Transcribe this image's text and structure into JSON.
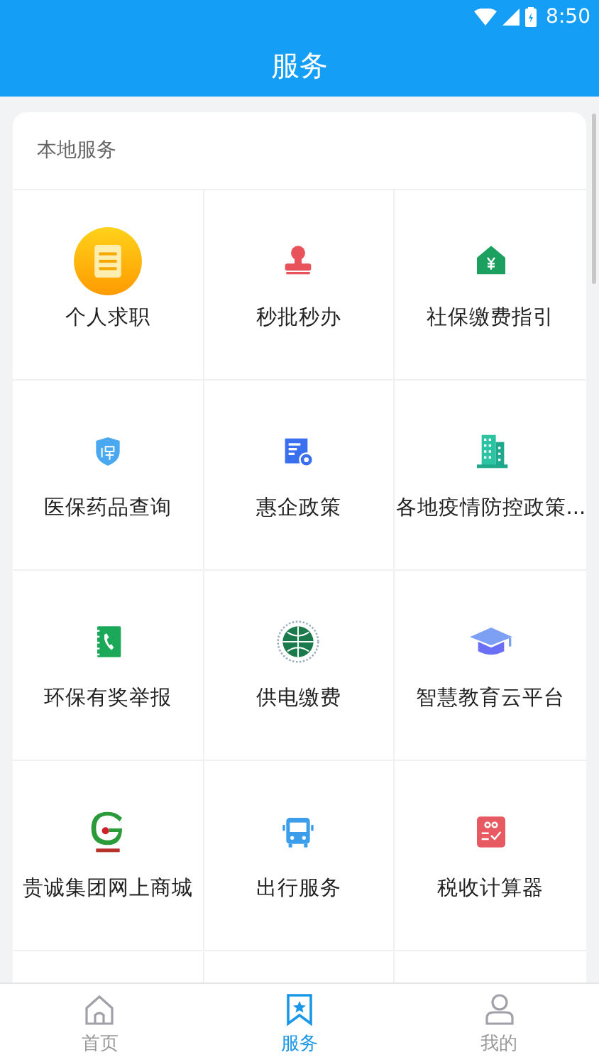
{
  "status_bar": {
    "time": "8:50"
  },
  "header": {
    "title": "服务"
  },
  "section": {
    "title": "本地服务",
    "items": [
      {
        "label": "个人求职",
        "kind": "resume"
      },
      {
        "label": "秒批秒办",
        "kind": "stamp"
      },
      {
        "label": "社保缴费指引",
        "kind": "house"
      },
      {
        "label": "医保药品查询",
        "kind": "shield"
      },
      {
        "label": "惠企政策",
        "kind": "document"
      },
      {
        "label": "各地疫情防控政策...",
        "kind": "building"
      },
      {
        "label": "环保有奖举报",
        "kind": "phonebook"
      },
      {
        "label": "供电缴费",
        "kind": "globe"
      },
      {
        "label": "智慧教育云平台",
        "kind": "cap"
      },
      {
        "label": "贵诚集团网上商城",
        "kind": "glogo"
      },
      {
        "label": "出行服务",
        "kind": "bus"
      },
      {
        "label": "税收计算器",
        "kind": "scoresheet"
      }
    ]
  },
  "nav": [
    {
      "label": "首页",
      "kind": "home",
      "selected": false
    },
    {
      "label": "服务",
      "kind": "bookmark",
      "selected": true
    },
    {
      "label": "我的",
      "kind": "person",
      "selected": false
    }
  ]
}
